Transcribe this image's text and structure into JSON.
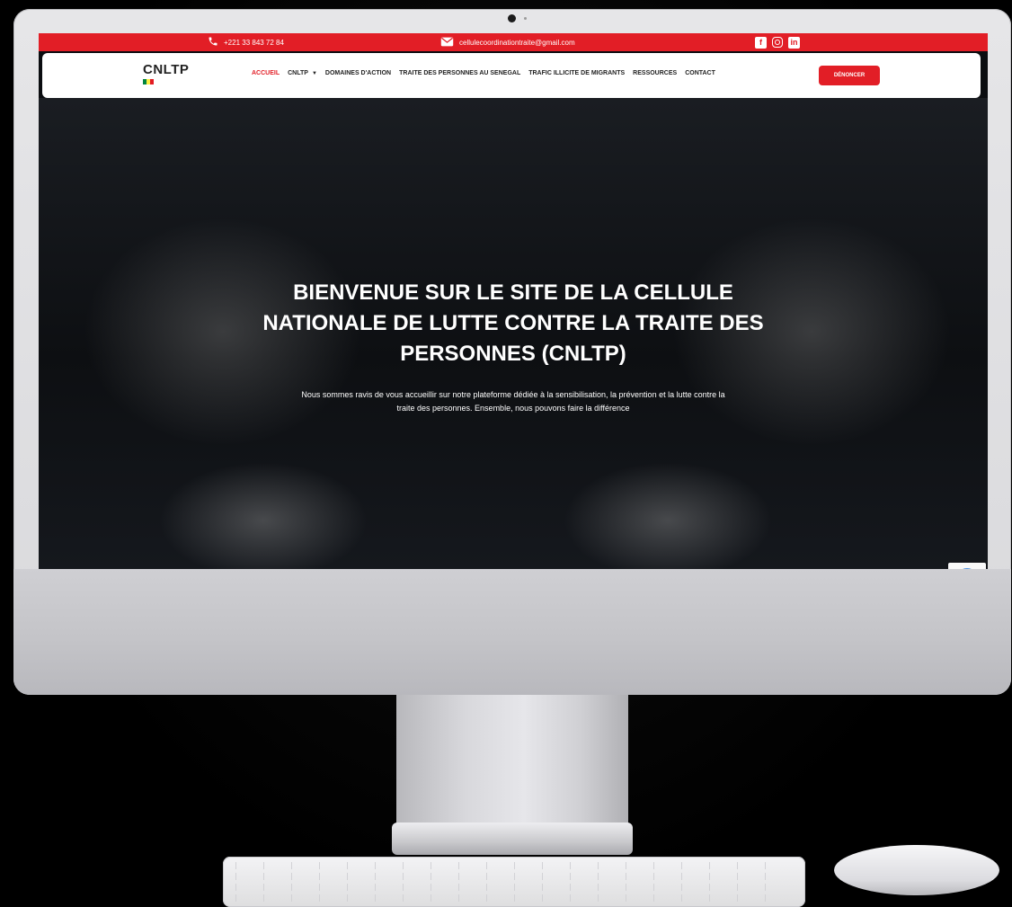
{
  "topbar": {
    "phone": "+221 33 843 72 84",
    "email": "cellulecoordinationtraite@gmail.com",
    "socials": [
      "facebook-icon",
      "instagram-icon",
      "linkedin-icon"
    ]
  },
  "nav": {
    "logo_text": "CNLTP",
    "items": [
      {
        "label": "ACCUEIL",
        "active": true
      },
      {
        "label": "CNLTP",
        "dropdown": true
      },
      {
        "label": "DOMAINES D'ACTION"
      },
      {
        "label": "TRAITE DES PERSONNES AU SENEGAL"
      },
      {
        "label": "TRAFIC ILLICITE DE MIGRANTS"
      },
      {
        "label": "RESSOURCES"
      },
      {
        "label": "CONTACT"
      }
    ],
    "cta": "DÉNONCER"
  },
  "hero": {
    "title_lines": [
      "BIENVENUE SUR LE SITE DE LA CELLULE",
      "NATIONALE DE LUTTE CONTRE LA TRAITE DES",
      "PERSONNES (CNLTP)"
    ],
    "text_lines": [
      "Nous sommes ravis de vous accueillir sur notre plateforme dédiée à la sensibilisation, la prévention et la lutte contre la",
      "traite des personnes. Ensemble, nous pouvons faire la différence"
    ]
  },
  "colors": {
    "brand_red": "#e21e26",
    "flag_green": "#00853f",
    "flag_yellow": "#fdef42",
    "flag_red": "#e31b23"
  }
}
